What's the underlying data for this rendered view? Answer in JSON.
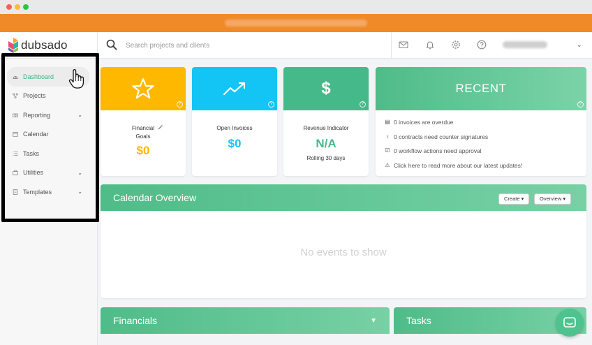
{
  "app": {
    "name": "dubsado"
  },
  "search": {
    "placeholder": "Search projects and clients"
  },
  "topbar_icons": [
    "envelope-icon",
    "bell-icon",
    "gear-icon",
    "help-icon"
  ],
  "sidebar": {
    "items": [
      {
        "label": "Dashboard",
        "icon": "dashboard-icon",
        "active": true,
        "expandable": false
      },
      {
        "label": "Projects",
        "icon": "projects-icon",
        "active": false,
        "expandable": false
      },
      {
        "label": "Reporting",
        "icon": "reporting-icon",
        "active": false,
        "expandable": true
      },
      {
        "label": "Calendar",
        "icon": "calendar-icon",
        "active": false,
        "expandable": false
      },
      {
        "label": "Tasks",
        "icon": "tasks-icon",
        "active": false,
        "expandable": false
      },
      {
        "label": "Utilities",
        "icon": "utilities-icon",
        "active": false,
        "expandable": true
      },
      {
        "label": "Templates",
        "icon": "templates-icon",
        "active": false,
        "expandable": true
      }
    ]
  },
  "cards": {
    "financial_goals": {
      "label_line1": "Financial",
      "label_line2": "Goals",
      "value": "$0",
      "color": "#ffb800",
      "icon": "star-icon"
    },
    "open_invoices": {
      "label": "Open Invoices",
      "value": "$0",
      "color": "#12c5f4",
      "icon": "trend-up-icon"
    },
    "revenue_indicator": {
      "label": "Revenue Indicator",
      "value": "N/A",
      "sub": "Rolling 30 days",
      "color": "#46b98a",
      "icon_text": "$"
    }
  },
  "recent": {
    "title": "RECENT",
    "items": [
      {
        "text": "0 invoices are overdue",
        "icon": "invoice-icon"
      },
      {
        "text": "0 contracts need counter signatures",
        "icon": "contract-icon"
      },
      {
        "text": "0 workflow actions need approval",
        "icon": "checkbox-icon"
      },
      {
        "text": "Click here to read more about our latest updates!",
        "icon": "warning-icon"
      }
    ]
  },
  "calendar": {
    "title": "Calendar Overview",
    "create_label": "Create ▾",
    "overview_label": "Overview ▾",
    "empty_text": "No events to show"
  },
  "panels": {
    "financials": {
      "title": "Financials"
    },
    "tasks": {
      "title": "Tasks"
    }
  },
  "colors": {
    "accent": "#3ab486",
    "banner": "#f08a28",
    "green_header": "#4fbc88"
  }
}
